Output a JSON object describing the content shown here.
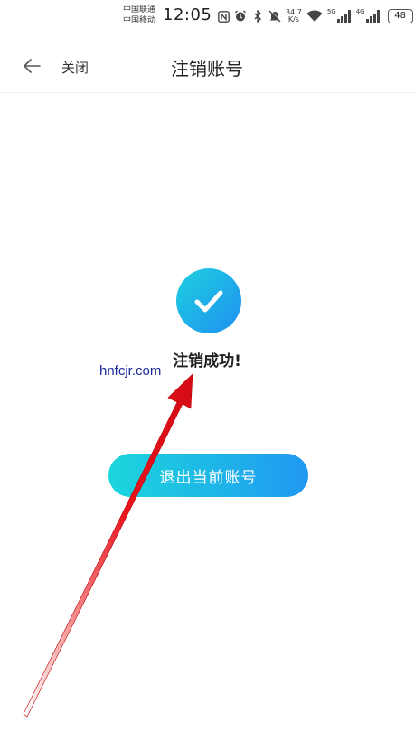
{
  "status_bar": {
    "carrier_1": "中国联通",
    "carrier_2": "中国移动",
    "time": "12:05",
    "speed_value": "34.7",
    "speed_unit": "K/s",
    "net_1": "5G",
    "net_2": "4G",
    "battery": "48",
    "icons": [
      "nfc-icon",
      "alarm-icon",
      "bluetooth-icon",
      "mute-icon",
      "wifi-icon",
      "signal-icon",
      "signal-icon"
    ]
  },
  "nav": {
    "close_label": "关闭",
    "title": "注销账号"
  },
  "main": {
    "success_text": "注销成功!",
    "logout_button": "退出当前账号"
  },
  "watermark": "hnfcjr.com",
  "colors": {
    "accent_start": "#1cd6dc",
    "accent_end": "#2198f2",
    "annotation_arrow": "#e8141e",
    "watermark": "#1b2b96"
  }
}
